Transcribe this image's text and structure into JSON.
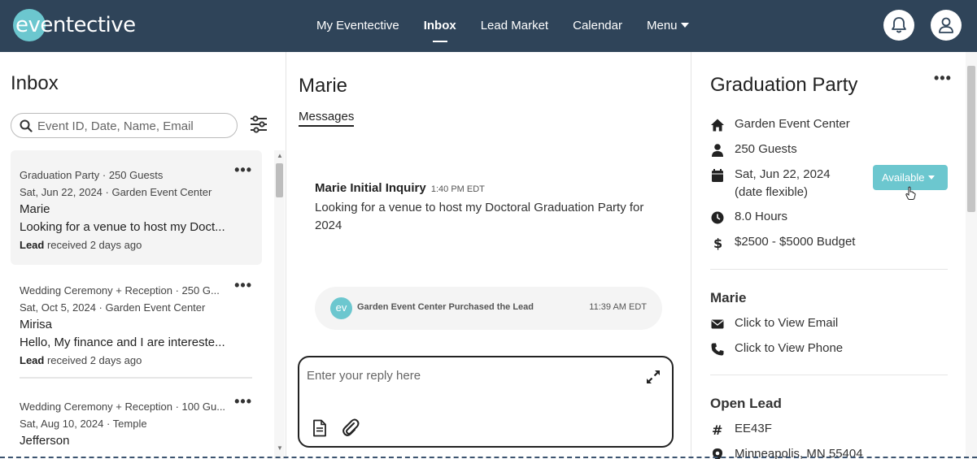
{
  "header": {
    "logo": "eventective",
    "nav": [
      {
        "label": "My Eventective"
      },
      {
        "label": "Inbox"
      },
      {
        "label": "Lead Market"
      },
      {
        "label": "Calendar"
      },
      {
        "label": "Menu"
      }
    ],
    "active_nav": "Inbox"
  },
  "inbox": {
    "title": "Inbox",
    "search_placeholder": "Event ID, Date, Name, Email",
    "conversations": [
      {
        "summary": "Graduation Party · 250 Guests",
        "date_venue": "Sat, Jun 22, 2024 · Garden Event Center",
        "name": "Marie",
        "preview": "Looking for a venue to host my Doct...",
        "status_label": "Lead",
        "status_text": "received 2   days ago"
      },
      {
        "summary": "Wedding Ceremony + Reception · 250 G...",
        "date_venue": "Sat, Oct 5, 2024 · Garden Event Center",
        "name": "Mirisa",
        "preview": "Hello, My finance and I are intereste...",
        "status_label": "Lead",
        "status_text": "received 2   days ago"
      },
      {
        "summary": "Wedding Ceremony + Reception · 100 Gu...",
        "date_venue": "Sat, Aug 10, 2024 · Temple",
        "name": "Jefferson",
        "preview": "",
        "status_label": "",
        "status_text": ""
      }
    ]
  },
  "conversation": {
    "contact_name": "Marie",
    "tab": "Messages",
    "message": {
      "title": "Marie Initial Inquiry",
      "time": "1:40 PM EDT",
      "body": "Looking for a venue to host my Doctoral Graduation Party for 2024"
    },
    "system_event": {
      "avatar": "ev",
      "text": "Garden Event Center Purchased the Lead",
      "time": "11:39 AM EDT"
    },
    "reply_placeholder": "Enter your reply here"
  },
  "details": {
    "event_title": "Graduation Party",
    "venue": "Garden Event Center",
    "guests": "250 Guests",
    "date": "Sat, Jun 22, 2024",
    "date_note": "(date flexible)",
    "availability": "Available",
    "duration": "8.0 Hours",
    "budget": "$2500 - $5000 Budget",
    "contact": {
      "name": "Marie",
      "email_link": "Click to View Email",
      "phone_link": "Click to View Phone"
    },
    "lead": {
      "title": "Open Lead",
      "id": "EE43F",
      "location": "Minneapolis, MN 55404"
    }
  },
  "colors": {
    "header_bg": "#2f4459",
    "accent": "#6cc7cf"
  },
  "icons": [
    "bell-icon",
    "user-icon",
    "search-icon",
    "filter-icon",
    "home-icon",
    "person-icon",
    "calendar-icon",
    "clock-icon",
    "dollar-icon",
    "mail-icon",
    "phone-icon",
    "hash-icon",
    "location-pin-icon",
    "expand-icon",
    "document-icon",
    "paperclip-icon"
  ]
}
